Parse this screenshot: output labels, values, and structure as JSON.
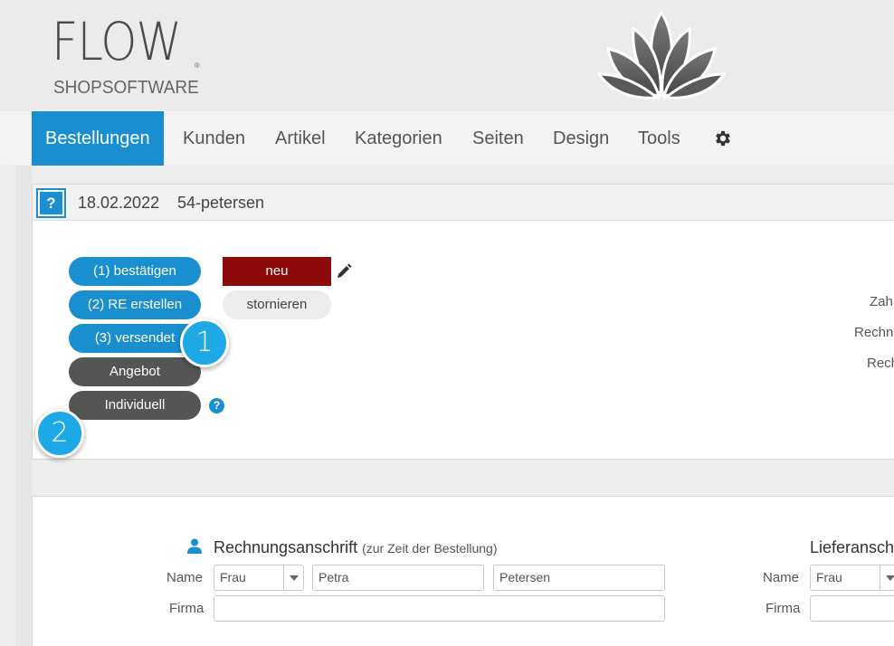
{
  "brand": {
    "name": "FLOW",
    "registered": "®",
    "subtitle": "SHOPSOFTWARE"
  },
  "nav": {
    "items": [
      {
        "label": "Bestellungen",
        "active": true
      },
      {
        "label": "Kunden"
      },
      {
        "label": "Artikel"
      },
      {
        "label": "Kategorien"
      },
      {
        "label": "Seiten"
      },
      {
        "label": "Design"
      },
      {
        "label": "Tools"
      }
    ],
    "settings_icon": "gear-icon"
  },
  "order": {
    "help_symbol": "?",
    "date": "18.02.2022",
    "customer": "54-petersen",
    "actions": [
      {
        "label": "(1) bestätigen"
      },
      {
        "label": "(2) RE erstellen"
      },
      {
        "label": "(3) versendet"
      },
      {
        "label": "Angebot"
      },
      {
        "label": "Individuell"
      }
    ],
    "status": {
      "label": "neu",
      "color": "#8e0b0b"
    },
    "cancel_label": "stornieren",
    "help_hint": "?",
    "right_labels": [
      "Zah",
      "Rechn",
      "Rech"
    ]
  },
  "callouts": [
    "1",
    "2"
  ],
  "billing": {
    "title": "Rechnungsanschrift",
    "subtitle": "(zur Zeit der Bestellung)",
    "name_label": "Name",
    "salutation": "Frau",
    "first_name": "Petra",
    "last_name": "Petersen",
    "company_label": "Firma"
  },
  "shipping": {
    "title": "Lieferansch",
    "name_label": "Name",
    "salutation": "Frau",
    "company_label": "Firma"
  },
  "colors": {
    "accent": "#1a8fcf",
    "status_new": "#8e0b0b",
    "callout": "#1ca9e6",
    "dark_button": "#555555"
  }
}
